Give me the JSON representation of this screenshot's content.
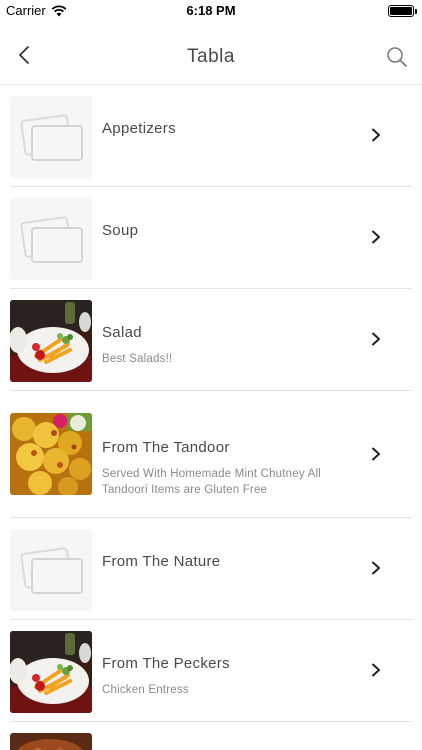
{
  "status_bar": {
    "carrier": "Carrier",
    "time": "6:18 PM"
  },
  "nav": {
    "title": "Tabla"
  },
  "categories": [
    {
      "title": "Appetizers",
      "subtitle": "",
      "image": "placeholder"
    },
    {
      "title": "Soup",
      "subtitle": "",
      "image": "placeholder"
    },
    {
      "title": "Salad",
      "subtitle": "Best Salads!!",
      "image": "salad-photo"
    },
    {
      "title": "From The Tandoor",
      "subtitle": "Served With Homemade Mint Chutney All Tandoori Items are Gluten Free",
      "image": "tandoor-photo"
    },
    {
      "title": "From The Nature",
      "subtitle": "",
      "image": "placeholder"
    },
    {
      "title": "From The Peckers",
      "subtitle": "Chicken Entress",
      "image": "salad-photo"
    }
  ]
}
